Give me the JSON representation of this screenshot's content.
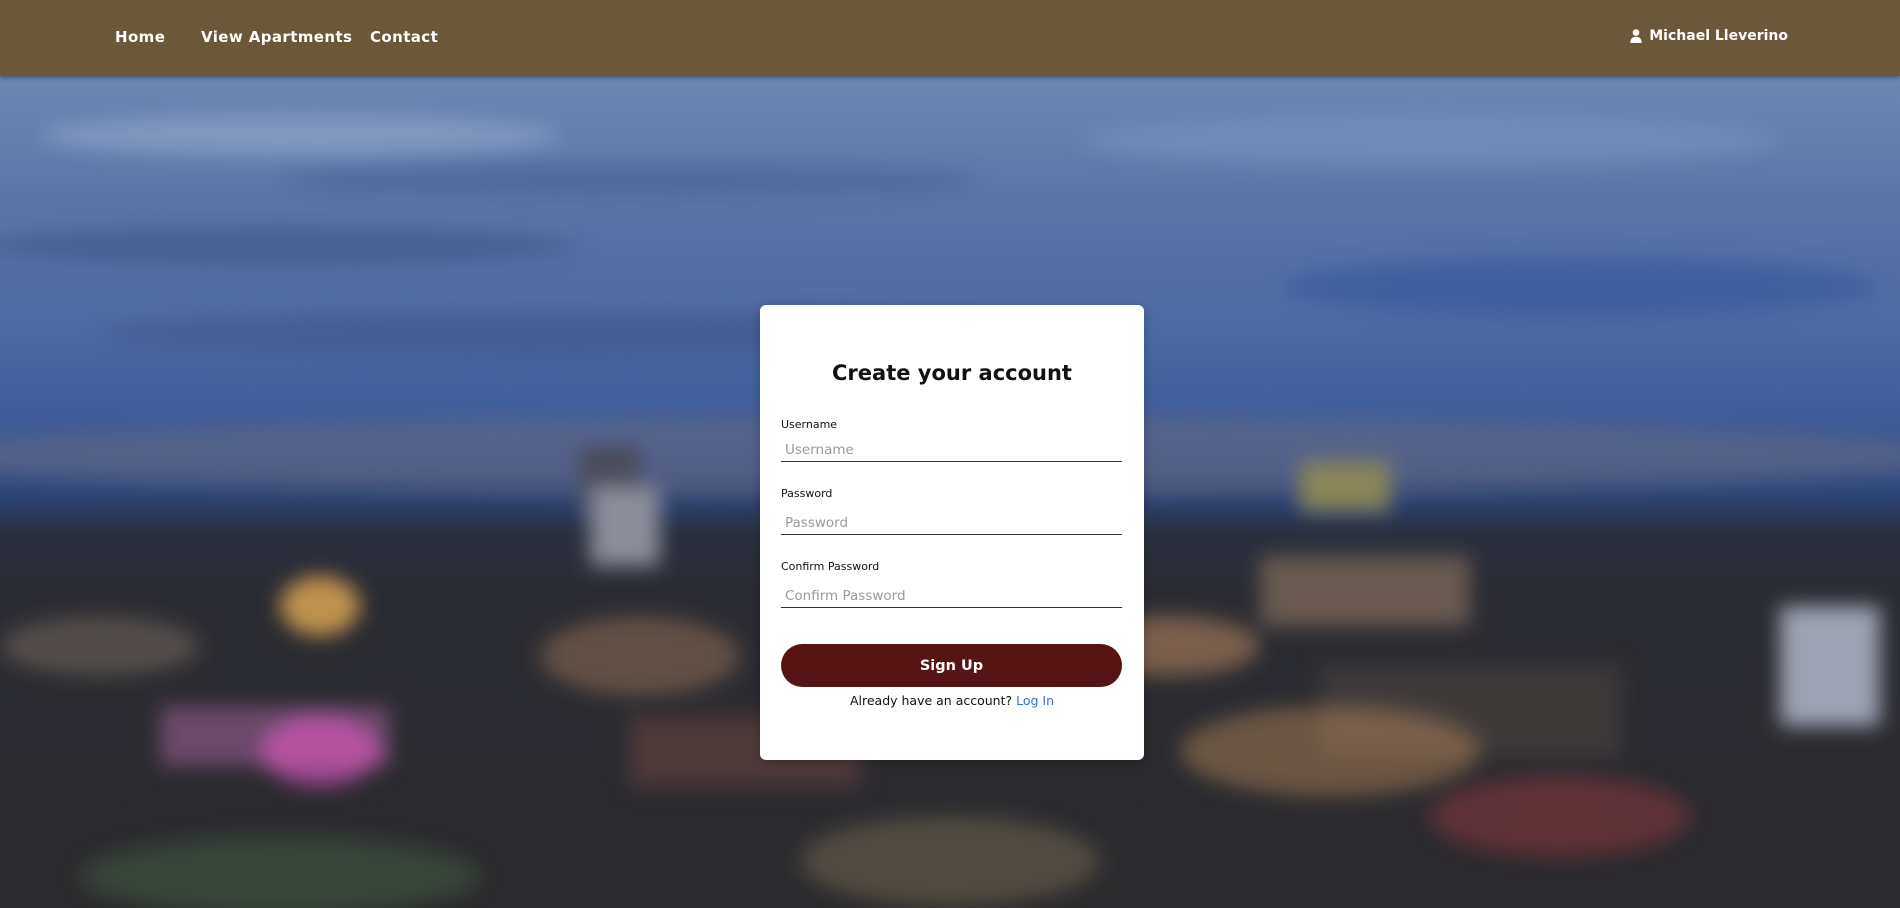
{
  "nav": {
    "home": "Home",
    "view_apartments": "View Apartments",
    "contact": "Contact",
    "user_name": "Michael Lleverino",
    "user_icon": "user-icon"
  },
  "form": {
    "title": "Create your account",
    "username_label": "Username",
    "username_placeholder": "Username",
    "username_value": "",
    "password_label": "Password",
    "password_placeholder": "Password",
    "password_value": "",
    "confirm_label": "Confirm Password",
    "confirm_placeholder": "Confirm Password",
    "confirm_value": "",
    "submit_label": "Sign Up",
    "login_prompt": "Already have an account?",
    "login_link": "Log In"
  },
  "colors": {
    "header_bg": "#6a5839",
    "button_bg": "#561414",
    "link": "#3b6fd6",
    "card_bg": "#ffffff"
  }
}
